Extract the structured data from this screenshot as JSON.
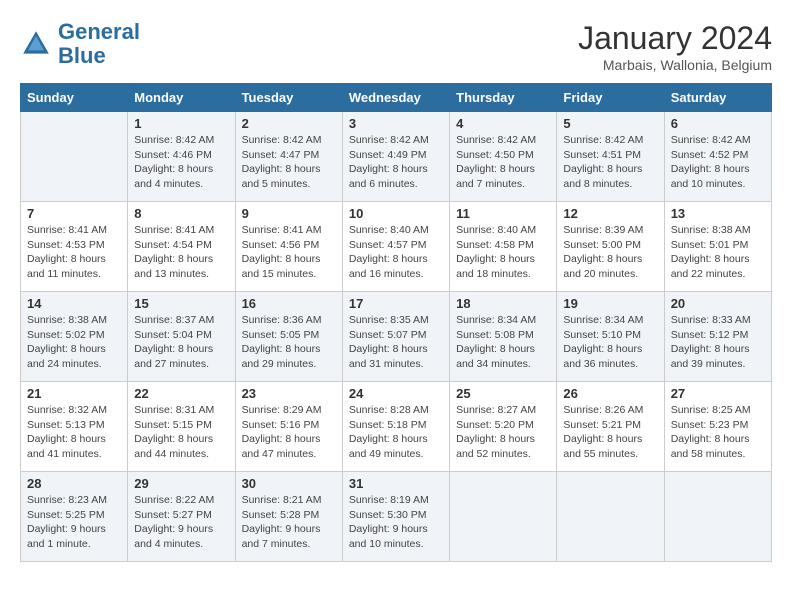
{
  "header": {
    "logo_general": "General",
    "logo_blue": "Blue",
    "month_title": "January 2024",
    "subtitle": "Marbais, Wallonia, Belgium"
  },
  "days_of_week": [
    "Sunday",
    "Monday",
    "Tuesday",
    "Wednesday",
    "Thursday",
    "Friday",
    "Saturday"
  ],
  "weeks": [
    [
      {
        "day": "",
        "info": ""
      },
      {
        "day": "1",
        "info": "Sunrise: 8:42 AM\nSunset: 4:46 PM\nDaylight: 8 hours\nand 4 minutes."
      },
      {
        "day": "2",
        "info": "Sunrise: 8:42 AM\nSunset: 4:47 PM\nDaylight: 8 hours\nand 5 minutes."
      },
      {
        "day": "3",
        "info": "Sunrise: 8:42 AM\nSunset: 4:49 PM\nDaylight: 8 hours\nand 6 minutes."
      },
      {
        "day": "4",
        "info": "Sunrise: 8:42 AM\nSunset: 4:50 PM\nDaylight: 8 hours\nand 7 minutes."
      },
      {
        "day": "5",
        "info": "Sunrise: 8:42 AM\nSunset: 4:51 PM\nDaylight: 8 hours\nand 8 minutes."
      },
      {
        "day": "6",
        "info": "Sunrise: 8:42 AM\nSunset: 4:52 PM\nDaylight: 8 hours\nand 10 minutes."
      }
    ],
    [
      {
        "day": "7",
        "info": "Sunrise: 8:41 AM\nSunset: 4:53 PM\nDaylight: 8 hours\nand 11 minutes."
      },
      {
        "day": "8",
        "info": "Sunrise: 8:41 AM\nSunset: 4:54 PM\nDaylight: 8 hours\nand 13 minutes."
      },
      {
        "day": "9",
        "info": "Sunrise: 8:41 AM\nSunset: 4:56 PM\nDaylight: 8 hours\nand 15 minutes."
      },
      {
        "day": "10",
        "info": "Sunrise: 8:40 AM\nSunset: 4:57 PM\nDaylight: 8 hours\nand 16 minutes."
      },
      {
        "day": "11",
        "info": "Sunrise: 8:40 AM\nSunset: 4:58 PM\nDaylight: 8 hours\nand 18 minutes."
      },
      {
        "day": "12",
        "info": "Sunrise: 8:39 AM\nSunset: 5:00 PM\nDaylight: 8 hours\nand 20 minutes."
      },
      {
        "day": "13",
        "info": "Sunrise: 8:38 AM\nSunset: 5:01 PM\nDaylight: 8 hours\nand 22 minutes."
      }
    ],
    [
      {
        "day": "14",
        "info": "Sunrise: 8:38 AM\nSunset: 5:02 PM\nDaylight: 8 hours\nand 24 minutes."
      },
      {
        "day": "15",
        "info": "Sunrise: 8:37 AM\nSunset: 5:04 PM\nDaylight: 8 hours\nand 27 minutes."
      },
      {
        "day": "16",
        "info": "Sunrise: 8:36 AM\nSunset: 5:05 PM\nDaylight: 8 hours\nand 29 minutes."
      },
      {
        "day": "17",
        "info": "Sunrise: 8:35 AM\nSunset: 5:07 PM\nDaylight: 8 hours\nand 31 minutes."
      },
      {
        "day": "18",
        "info": "Sunrise: 8:34 AM\nSunset: 5:08 PM\nDaylight: 8 hours\nand 34 minutes."
      },
      {
        "day": "19",
        "info": "Sunrise: 8:34 AM\nSunset: 5:10 PM\nDaylight: 8 hours\nand 36 minutes."
      },
      {
        "day": "20",
        "info": "Sunrise: 8:33 AM\nSunset: 5:12 PM\nDaylight: 8 hours\nand 39 minutes."
      }
    ],
    [
      {
        "day": "21",
        "info": "Sunrise: 8:32 AM\nSunset: 5:13 PM\nDaylight: 8 hours\nand 41 minutes."
      },
      {
        "day": "22",
        "info": "Sunrise: 8:31 AM\nSunset: 5:15 PM\nDaylight: 8 hours\nand 44 minutes."
      },
      {
        "day": "23",
        "info": "Sunrise: 8:29 AM\nSunset: 5:16 PM\nDaylight: 8 hours\nand 47 minutes."
      },
      {
        "day": "24",
        "info": "Sunrise: 8:28 AM\nSunset: 5:18 PM\nDaylight: 8 hours\nand 49 minutes."
      },
      {
        "day": "25",
        "info": "Sunrise: 8:27 AM\nSunset: 5:20 PM\nDaylight: 8 hours\nand 52 minutes."
      },
      {
        "day": "26",
        "info": "Sunrise: 8:26 AM\nSunset: 5:21 PM\nDaylight: 8 hours\nand 55 minutes."
      },
      {
        "day": "27",
        "info": "Sunrise: 8:25 AM\nSunset: 5:23 PM\nDaylight: 8 hours\nand 58 minutes."
      }
    ],
    [
      {
        "day": "28",
        "info": "Sunrise: 8:23 AM\nSunset: 5:25 PM\nDaylight: 9 hours\nand 1 minute."
      },
      {
        "day": "29",
        "info": "Sunrise: 8:22 AM\nSunset: 5:27 PM\nDaylight: 9 hours\nand 4 minutes."
      },
      {
        "day": "30",
        "info": "Sunrise: 8:21 AM\nSunset: 5:28 PM\nDaylight: 9 hours\nand 7 minutes."
      },
      {
        "day": "31",
        "info": "Sunrise: 8:19 AM\nSunset: 5:30 PM\nDaylight: 9 hours\nand 10 minutes."
      },
      {
        "day": "",
        "info": ""
      },
      {
        "day": "",
        "info": ""
      },
      {
        "day": "",
        "info": ""
      }
    ]
  ]
}
